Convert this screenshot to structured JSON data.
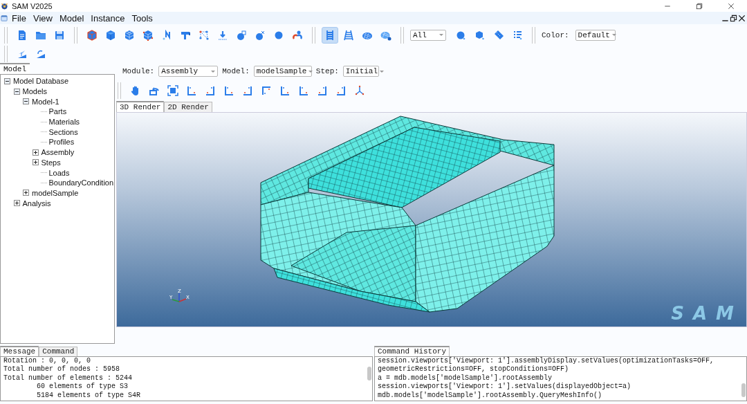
{
  "window": {
    "title": "SAM V2025"
  },
  "menu": [
    "File",
    "View",
    "Model",
    "Instance",
    "Tools"
  ],
  "toolbar": {
    "mesh_tools": [
      {
        "selected": true
      },
      {
        "selected": false
      },
      {
        "selected": false
      },
      {
        "selected": false
      }
    ],
    "filter": "All",
    "color_label": "Color:",
    "color_scheme": "Default"
  },
  "model_panel": {
    "tab": "Model",
    "tree": [
      {
        "label": "Model Database",
        "expanded": true,
        "children": [
          {
            "label": "Models",
            "expanded": true,
            "children": [
              {
                "label": "Model-1",
                "expanded": true,
                "children": [
                  {
                    "label": "Parts"
                  },
                  {
                    "label": "Materials"
                  },
                  {
                    "label": "Sections"
                  },
                  {
                    "label": "Profiles"
                  },
                  {
                    "label": "Assembly",
                    "expanded": false
                  },
                  {
                    "label": "Steps",
                    "expanded": false
                  },
                  {
                    "label": "Loads"
                  },
                  {
                    "label": "BoundaryCondition"
                  }
                ]
              },
              {
                "label": "modelSample",
                "expanded": false
              }
            ]
          },
          {
            "label": "Analysis",
            "expanded": false
          }
        ]
      }
    ]
  },
  "context_bar": {
    "module_label": "Module:",
    "module": "Assembly",
    "model_label": "Model:",
    "model": "modelSample",
    "step_label": "Step:",
    "step": "Initial"
  },
  "render_tabs": [
    {
      "label": "3D Render",
      "selected": true
    },
    {
      "label": "2D Render",
      "selected": false
    }
  ],
  "viewport": {
    "triad": [
      "Z",
      "Y",
      "X"
    ],
    "logo": "S A M"
  },
  "message_tabs": [
    {
      "label": "Message",
      "selected": true
    },
    {
      "label": "Command",
      "selected": false
    }
  ],
  "messages": [
    "Rotation : 0, 0, 0, 0",
    "Total number of nodes : 5958",
    "Total number of elements : 5244",
    "        60 elements of type S3",
    "        5184 elements of type S4R"
  ],
  "history_tab": "Command History",
  "history": [
    "session.viewports['Viewport: 1'].assemblyDisplay.setValues(optimizationTasks=OFF,",
    "geometricRestrictions=OFF, stopConditions=OFF)",
    "a = mdb.models['modelSample'].rootAssembly",
    "session.viewports['Viewport: 1'].setValues(displayedObject=a)",
    "mdb.models['modelSample'].rootAssembly.QueryMeshInfo()"
  ]
}
